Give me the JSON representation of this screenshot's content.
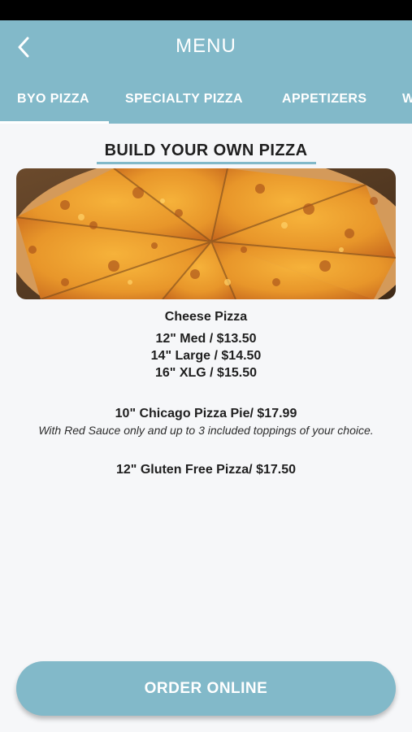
{
  "header": {
    "title": "MENU",
    "back_icon": "chevron-left-icon",
    "tabs": [
      {
        "label": "BYO PIZZA",
        "active": true
      },
      {
        "label": "SPECIALTY PIZZA",
        "active": false
      },
      {
        "label": "APPETIZERS",
        "active": false
      },
      {
        "label": "W",
        "active": false
      }
    ]
  },
  "section": {
    "title": "BUILD YOUR OWN PIZZA",
    "image_name": "cheese-pizza-image"
  },
  "items": {
    "cheese_title": "Cheese Pizza",
    "cheese_prices": [
      "12\" Med / $13.50",
      "14\" Large / $14.50",
      "16\" XLG / $15.50"
    ],
    "chicago_title": "10\" Chicago Pizza Pie/ $17.99",
    "chicago_note": "With Red Sauce only and up to 3 included toppings of your choice.",
    "gluten_title": "12\" Gluten Free Pizza/ $17.50"
  },
  "order_button": "ORDER ONLINE",
  "colors": {
    "accent": "#82b9c9",
    "background": "#f6f7f9",
    "text": "#1f1f1f"
  }
}
